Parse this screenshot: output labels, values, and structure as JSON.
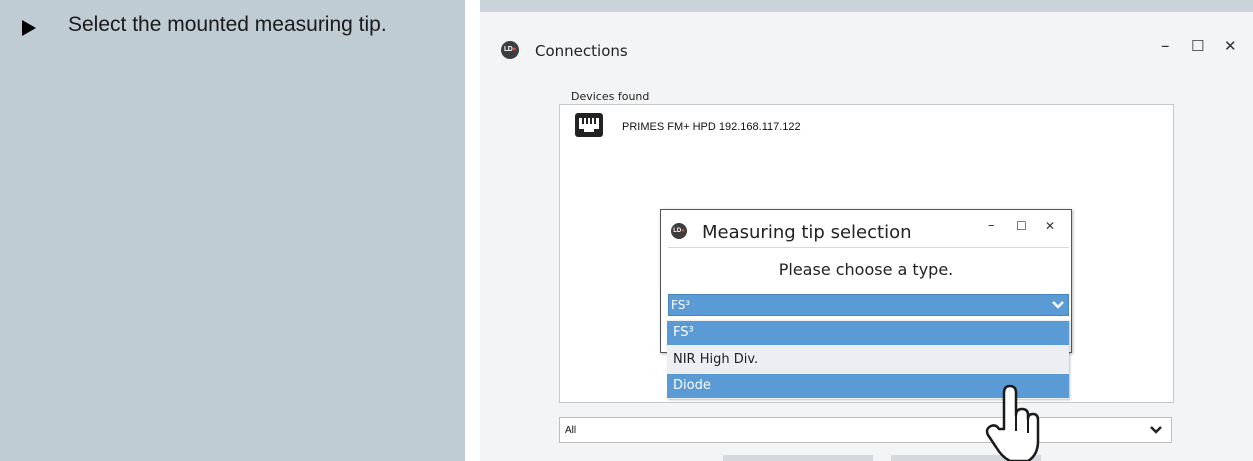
{
  "instruction": {
    "text": "Select the mounted measuring tip."
  },
  "window": {
    "title": "Connections",
    "logo_text": "LD",
    "controls": {
      "minimize": "–",
      "maximize": "☐",
      "close": "✕"
    }
  },
  "devices": {
    "label": "Devices found",
    "items": [
      {
        "label": "PRIMES FM+ HPD 192.168.117.122",
        "icon": "network-port-icon"
      }
    ]
  },
  "filter": {
    "value": "All"
  },
  "dialog": {
    "title": "Measuring tip selection",
    "logo_text": "LD",
    "controls": {
      "minimize": "–",
      "maximize": "☐",
      "close": "✕"
    },
    "prompt": "Please choose a type.",
    "select_value": "FS³",
    "options": [
      "FS³",
      "NIR High Div.",
      "Diode"
    ],
    "highlighted": [
      "FS³",
      "Diode"
    ]
  },
  "colors": {
    "accent": "#5b9bd5",
    "left_panel": "#bfccd4",
    "window_bg": "#f3f4f6",
    "logo_dot": "#e8482f"
  },
  "cursor": {
    "icon": "pointing-hand-cursor-icon"
  }
}
